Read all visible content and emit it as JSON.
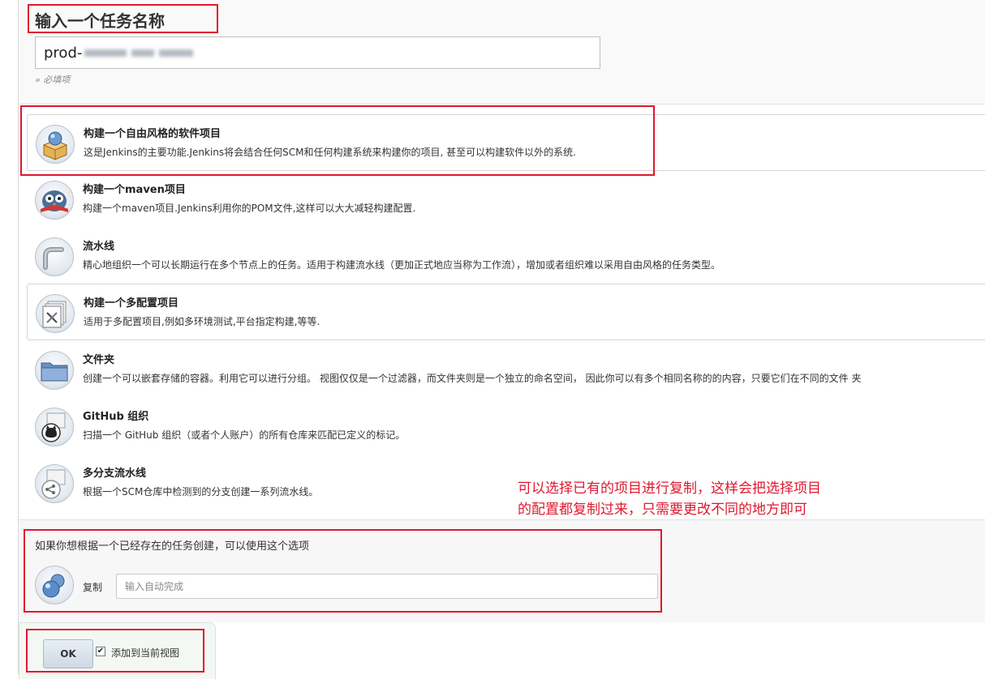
{
  "name_section": {
    "title": "输入一个任务名称",
    "name_value": "prod-",
    "required_hint": "» 必填项"
  },
  "job_types": [
    {
      "name": "构建一个自由风格的软件项目",
      "desc": "这是Jenkins的主要功能.Jenkins将会结合任何SCM和任何构建系统来构建你的项目, 甚至可以构建软件以外的系统.",
      "icon": "freestyle-box-icon"
    },
    {
      "name": "构建一个maven项目",
      "desc": "构建一个maven项目.Jenkins利用你的POM文件,这样可以大大减轻构建配置.",
      "icon": "maven-owl-icon"
    },
    {
      "name": "流水线",
      "desc": "精心地组织一个可以长期运行在多个节点上的任务。适用于构建流水线（更加正式地应当称为工作流），增加或者组织难以采用自由风格的任务类型。",
      "icon": "pipeline-icon"
    },
    {
      "name": "构建一个多配置项目",
      "desc": "适用于多配置项目,例如多环境测试,平台指定构建,等等.",
      "icon": "multi-config-icon"
    },
    {
      "name": "文件夹",
      "desc": "创建一个可以嵌套存储的容器。利用它可以进行分组。 视图仅仅是一个过滤器，而文件夹则是一个独立的命名空间， 因此你可以有多个相同名称的的内容，只要它们在不同的文件 夹",
      "icon": "folder-icon"
    },
    {
      "name": "GitHub 组织",
      "desc": "扫描一个 GitHub 组织（或者个人账户）的所有仓库来匹配已定义的标记。",
      "icon": "github-org-icon"
    },
    {
      "name": "多分支流水线",
      "desc": "根据一个SCM仓库中检测到的分支创建一系列流水线。",
      "icon": "multibranch-icon"
    }
  ],
  "copy_section": {
    "description": "如果你想根据一个已经存在的任务创建，可以使用这个选项",
    "label": "复制",
    "placeholder": "输入自动完成"
  },
  "annotation": {
    "line1": "可以选择已有的项目进行复制，这样会把选择项目",
    "line2": "的配置都复制过来，只需要更改不同的地方即可"
  },
  "footer": {
    "ok_label": "OK",
    "checkbox_label": "添加到当前视图",
    "checkbox_checked": true
  },
  "colors": {
    "highlight": "#e0182e",
    "annotation_text": "#e0182e"
  }
}
